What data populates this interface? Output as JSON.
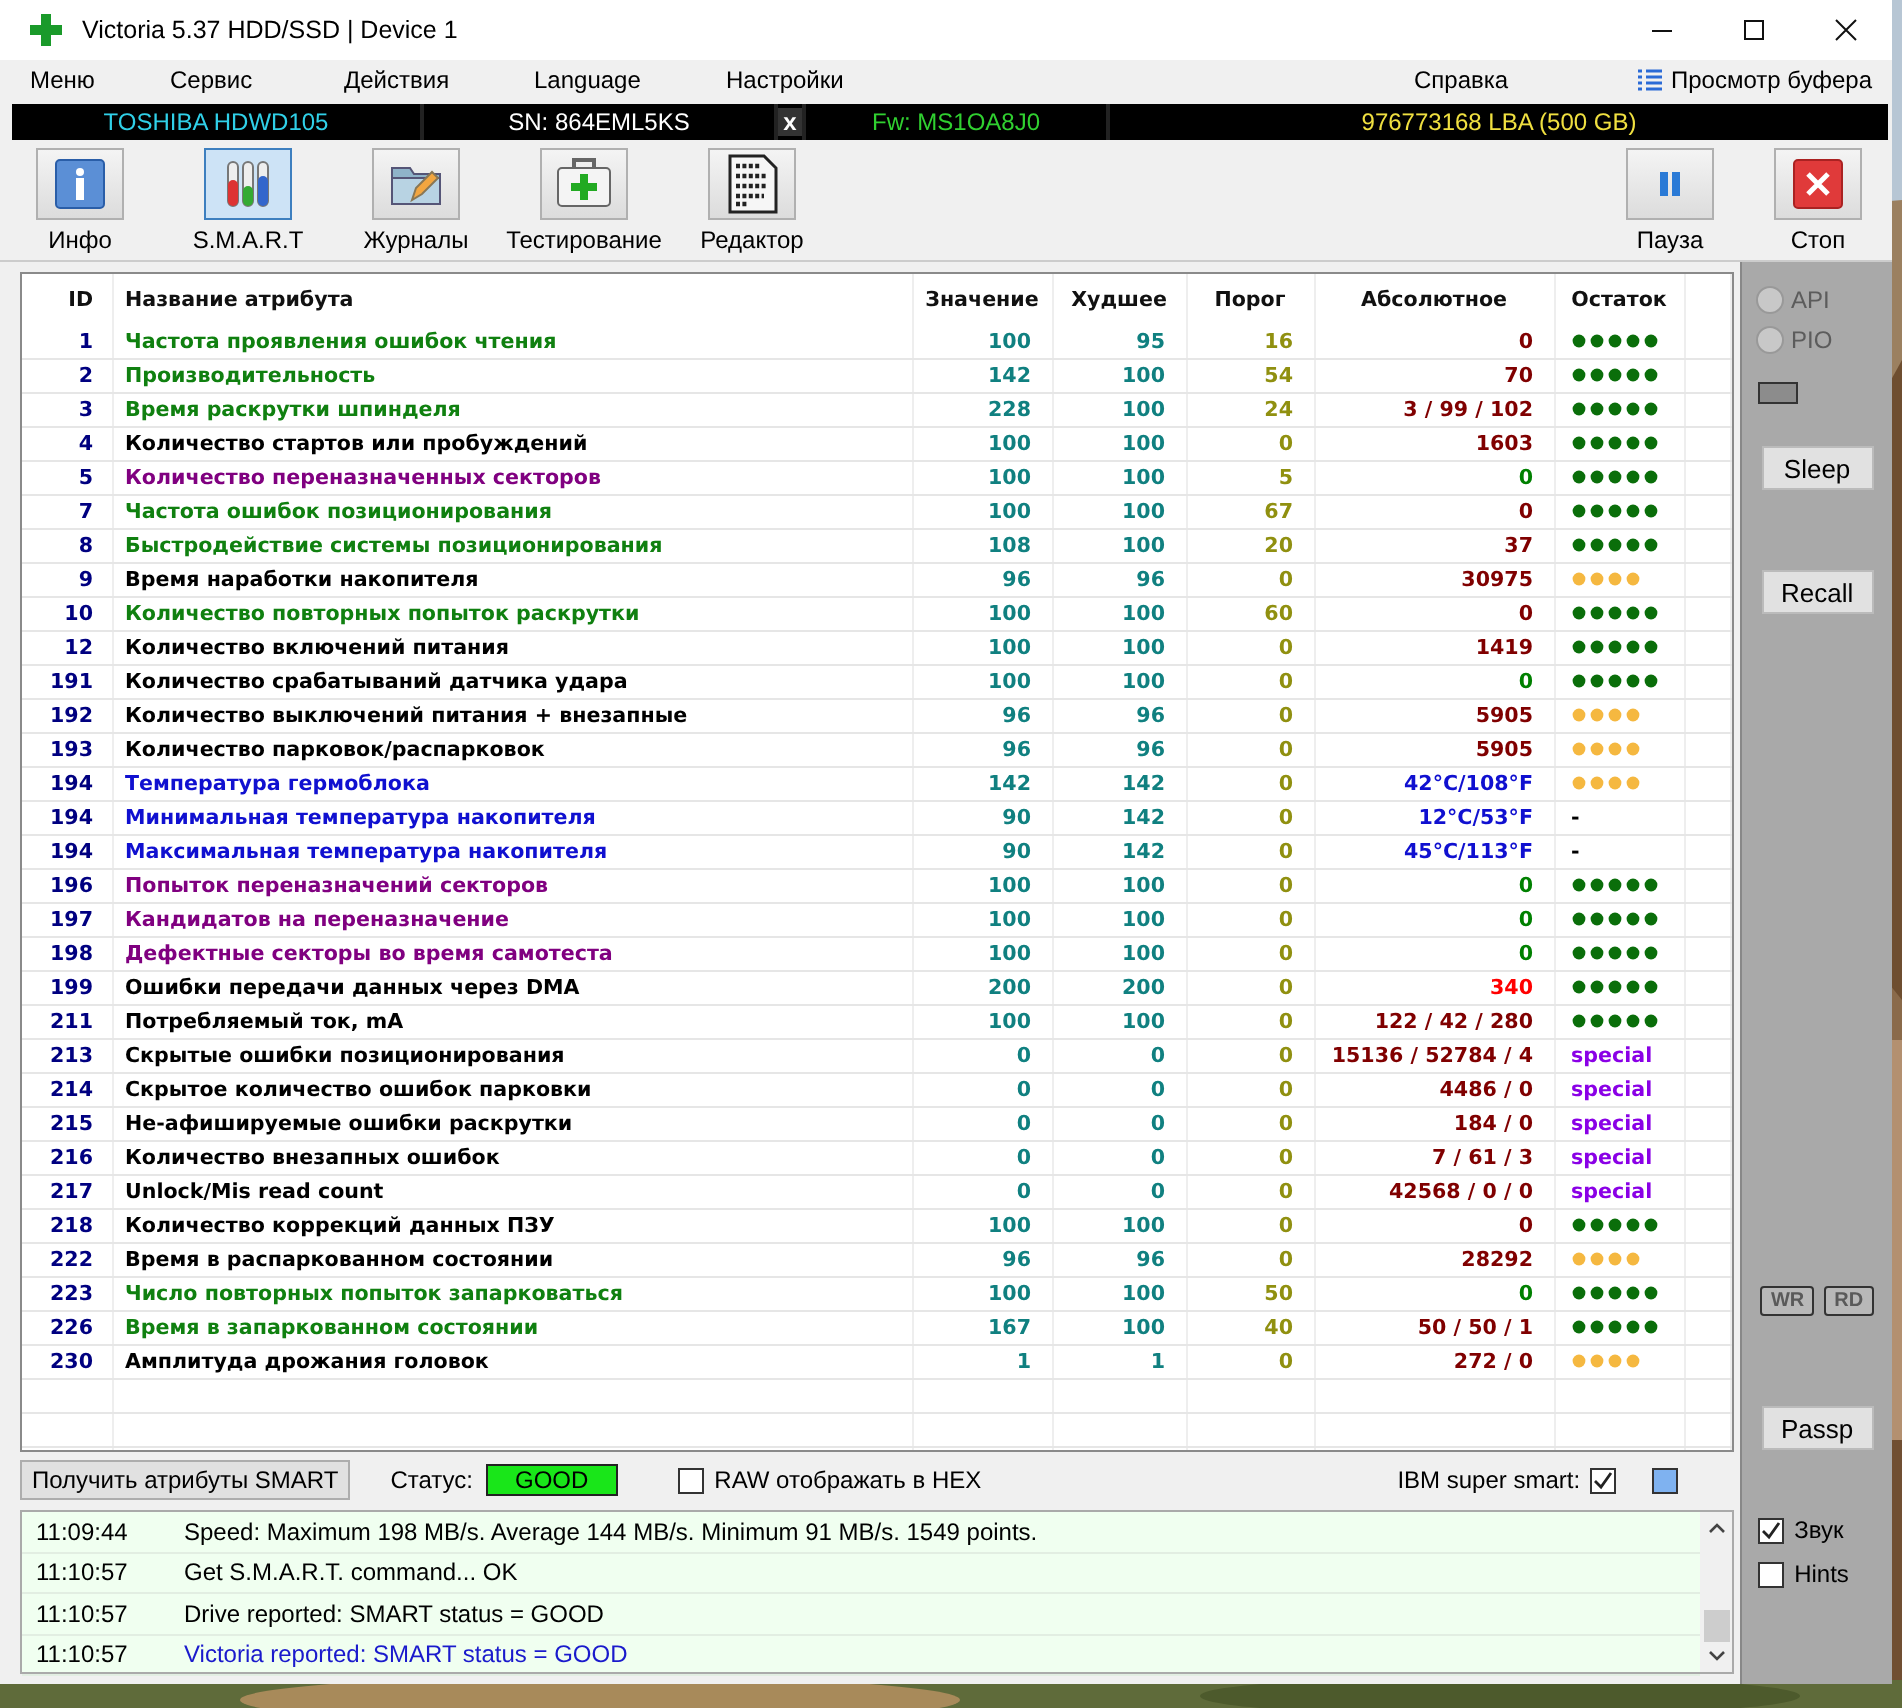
{
  "window": {
    "title": "Victoria 5.37 HDD/SSD | Device 1"
  },
  "menu": [
    "Меню",
    "Сервис",
    "Действия",
    "Language",
    "Настройки"
  ],
  "help_menu": "Справка",
  "buffer_view": "Просмотр буфера",
  "drive": {
    "model": "TOSHIBA HDWD105",
    "serial": "SN: 864EML5KS",
    "close": "x",
    "firmware": "Fw: MS1OA8J0",
    "capacity": "976773168 LBA (500 GB)"
  },
  "toolbar": [
    {
      "label": "Инфо",
      "kind": "info",
      "selected": false
    },
    {
      "label": "S.M.A.R.T",
      "kind": "smart",
      "selected": true
    },
    {
      "label": "Журналы",
      "kind": "logs",
      "selected": false
    },
    {
      "label": "Тестирование",
      "kind": "test",
      "selected": false
    },
    {
      "label": "Редактор",
      "kind": "editor",
      "selected": false
    }
  ],
  "toolbar_right": [
    {
      "label": "Пауза",
      "kind": "pause"
    },
    {
      "label": "Стоп",
      "kind": "stop"
    }
  ],
  "table": {
    "columns": [
      "ID",
      "Название атрибута",
      "Значение",
      "Худшее",
      "Порог",
      "Абсолютное",
      "Остаток"
    ],
    "rows": [
      {
        "id": "1",
        "name": "Частота проявления ошибок чтения",
        "color": "#108010",
        "value": "100",
        "worst": "95",
        "threshold": "16",
        "raw": {
          "text": "0",
          "color": "#800000"
        },
        "health": {
          "kind": "good"
        }
      },
      {
        "id": "2",
        "name": "Производительность",
        "color": "#108010",
        "value": "142",
        "worst": "100",
        "threshold": "54",
        "raw": {
          "text": "70",
          "color": "#800000"
        },
        "health": {
          "kind": "good"
        }
      },
      {
        "id": "3",
        "name": "Время раскрутки шпинделя",
        "color": "#108010",
        "value": "228",
        "worst": "100",
        "threshold": "24",
        "raw": {
          "text": "3 / 99 / 102",
          "color": "#800000"
        },
        "health": {
          "kind": "good"
        }
      },
      {
        "id": "4",
        "name": "Количество стартов или пробуждений",
        "color": "#000000",
        "value": "100",
        "worst": "100",
        "threshold": "0",
        "raw": {
          "text": "1603",
          "color": "#800000"
        },
        "health": {
          "kind": "good"
        }
      },
      {
        "id": "5",
        "name": "Количество переназначенных секторов",
        "color": "#800080",
        "value": "100",
        "worst": "100",
        "threshold": "5",
        "raw": {
          "text": "0",
          "color": "#008000"
        },
        "health": {
          "kind": "good"
        }
      },
      {
        "id": "7",
        "name": "Частота ошибок позиционирования",
        "color": "#108010",
        "value": "100",
        "worst": "100",
        "threshold": "67",
        "raw": {
          "text": "0",
          "color": "#800000"
        },
        "health": {
          "kind": "good"
        }
      },
      {
        "id": "8",
        "name": "Быстродействие системы позиционирования",
        "color": "#108010",
        "value": "108",
        "worst": "100",
        "threshold": "20",
        "raw": {
          "text": "37",
          "color": "#800000"
        },
        "health": {
          "kind": "good"
        }
      },
      {
        "id": "9",
        "name": "Время наработки накопителя",
        "color": "#000000",
        "value": "96",
        "worst": "96",
        "threshold": "0",
        "raw": {
          "text": "30975",
          "color": "#800000"
        },
        "health": {
          "kind": "fair"
        }
      },
      {
        "id": "10",
        "name": "Количество повторных попыток раскрутки",
        "color": "#108010",
        "value": "100",
        "worst": "100",
        "threshold": "60",
        "raw": {
          "text": "0",
          "color": "#800000"
        },
        "health": {
          "kind": "good"
        }
      },
      {
        "id": "12",
        "name": "Количество включений питания",
        "color": "#000000",
        "value": "100",
        "worst": "100",
        "threshold": "0",
        "raw": {
          "text": "1419",
          "color": "#800000"
        },
        "health": {
          "kind": "good"
        }
      },
      {
        "id": "191",
        "name": "Количество срабатываний датчика удара",
        "color": "#000000",
        "value": "100",
        "worst": "100",
        "threshold": "0",
        "raw": {
          "text": "0",
          "color": "#008000"
        },
        "health": {
          "kind": "good"
        }
      },
      {
        "id": "192",
        "name": "Количество выключений питания + внезапные",
        "color": "#000000",
        "value": "96",
        "worst": "96",
        "threshold": "0",
        "raw": {
          "text": "5905",
          "color": "#800000"
        },
        "health": {
          "kind": "fair"
        }
      },
      {
        "id": "193",
        "name": "Количество парковок/распарковок",
        "color": "#000000",
        "value": "96",
        "worst": "96",
        "threshold": "0",
        "raw": {
          "text": "5905",
          "color": "#800000"
        },
        "health": {
          "kind": "fair"
        }
      },
      {
        "id": "194",
        "name": "Температура гермоблока",
        "color": "#1010d0",
        "value": "142",
        "worst": "142",
        "threshold": "0",
        "raw": {
          "text": "42°C/108°F",
          "color": "#1010d0"
        },
        "health": {
          "kind": "fair"
        }
      },
      {
        "id": "194",
        "name": "Минимальная температура накопителя",
        "color": "#1010d0",
        "value": "90",
        "worst": "142",
        "threshold": "0",
        "raw": {
          "text": "12°C/53°F",
          "color": "#1010d0"
        },
        "health": {
          "kind": "text",
          "text": "-"
        }
      },
      {
        "id": "194",
        "name": "Максимальная температура накопителя",
        "color": "#1010d0",
        "value": "90",
        "worst": "142",
        "threshold": "0",
        "raw": {
          "text": "45°C/113°F",
          "color": "#1010d0"
        },
        "health": {
          "kind": "text",
          "text": "-"
        }
      },
      {
        "id": "196",
        "name": "Попыток переназначений секторов",
        "color": "#800080",
        "value": "100",
        "worst": "100",
        "threshold": "0",
        "raw": {
          "text": "0",
          "color": "#008000"
        },
        "health": {
          "kind": "good"
        }
      },
      {
        "id": "197",
        "name": "Кандидатов на переназначение",
        "color": "#800080",
        "value": "100",
        "worst": "100",
        "threshold": "0",
        "raw": {
          "text": "0",
          "color": "#008000"
        },
        "health": {
          "kind": "good"
        }
      },
      {
        "id": "198",
        "name": "Дефектные секторы во время самотеста",
        "color": "#800080",
        "value": "100",
        "worst": "100",
        "threshold": "0",
        "raw": {
          "text": "0",
          "color": "#008000"
        },
        "health": {
          "kind": "good"
        }
      },
      {
        "id": "199",
        "name": "Ошибки передачи данных через DMA",
        "color": "#000000",
        "value": "200",
        "worst": "200",
        "threshold": "0",
        "raw": {
          "text": "340",
          "color": "#ff0000"
        },
        "health": {
          "kind": "good"
        }
      },
      {
        "id": "211",
        "name": "Потребляемый ток, mA",
        "color": "#000000",
        "value": "100",
        "worst": "100",
        "threshold": "0",
        "raw": {
          "text": "122 / 42 / 280",
          "color": "#800000"
        },
        "health": {
          "kind": "good"
        }
      },
      {
        "id": "213",
        "name": "Скрытые ошибки позиционирования",
        "color": "#000000",
        "value": "0",
        "worst": "0",
        "threshold": "0",
        "raw": {
          "text": "15136 / 52784 / 4",
          "color": "#800000"
        },
        "health": {
          "kind": "special",
          "text": "special"
        }
      },
      {
        "id": "214",
        "name": "Скрытое количество ошибок парковки",
        "color": "#000000",
        "value": "0",
        "worst": "0",
        "threshold": "0",
        "raw": {
          "text": "4486 / 0",
          "color": "#800000"
        },
        "health": {
          "kind": "special",
          "text": "special"
        }
      },
      {
        "id": "215",
        "name": "Не-афишируемые ошибки раскрутки",
        "color": "#000000",
        "value": "0",
        "worst": "0",
        "threshold": "0",
        "raw": {
          "text": "184 / 0",
          "color": "#800000"
        },
        "health": {
          "kind": "special",
          "text": "special"
        }
      },
      {
        "id": "216",
        "name": "Количество внезапных ошибок",
        "color": "#000000",
        "value": "0",
        "worst": "0",
        "threshold": "0",
        "raw": {
          "text": "7 / 61 / 3",
          "color": "#800000"
        },
        "health": {
          "kind": "special",
          "text": "special"
        }
      },
      {
        "id": "217",
        "name": "Unlock/Mis read count",
        "color": "#000000",
        "value": "0",
        "worst": "0",
        "threshold": "0",
        "raw": {
          "text": "42568 / 0 / 0",
          "color": "#800000"
        },
        "health": {
          "kind": "special",
          "text": "special"
        }
      },
      {
        "id": "218",
        "name": "Количество коррекций данных ПЗУ",
        "color": "#000000",
        "value": "100",
        "worst": "100",
        "threshold": "0",
        "raw": {
          "text": "0",
          "color": "#800000"
        },
        "health": {
          "kind": "good"
        }
      },
      {
        "id": "222",
        "name": "Время в распаркованном состоянии",
        "color": "#000000",
        "value": "96",
        "worst": "96",
        "threshold": "0",
        "raw": {
          "text": "28292",
          "color": "#800000"
        },
        "health": {
          "kind": "fair"
        }
      },
      {
        "id": "223",
        "name": "Число повторных попыток запарковаться",
        "color": "#108010",
        "value": "100",
        "worst": "100",
        "threshold": "50",
        "raw": {
          "text": "0",
          "color": "#008000"
        },
        "health": {
          "kind": "good"
        }
      },
      {
        "id": "226",
        "name": "Время в запаркованном состоянии",
        "color": "#108010",
        "value": "167",
        "worst": "100",
        "threshold": "40",
        "raw": {
          "text": "50 / 50 / 1",
          "color": "#800000"
        },
        "health": {
          "kind": "good"
        }
      },
      {
        "id": "230",
        "name": "Амплитуда дрожания головок",
        "color": "#000000",
        "value": "1",
        "worst": "1",
        "threshold": "0",
        "raw": {
          "text": "272 / 0",
          "color": "#800000"
        },
        "health": {
          "kind": "fair"
        }
      }
    ]
  },
  "side": {
    "modes": [
      {
        "label": "API",
        "checked": false,
        "disabled": true
      },
      {
        "label": "PIO",
        "checked": false,
        "disabled": true
      }
    ],
    "buttons": [
      "Sleep",
      "Recall"
    ],
    "indicators": [
      "WR",
      "RD"
    ],
    "passp": "Passp"
  },
  "smart_bar": {
    "button": "Получить атрибуты SMART",
    "status_label": "Статус:",
    "status": "GOOD",
    "raw_hex": {
      "label": "RAW отображать в HEX",
      "checked": false
    },
    "ibm": {
      "label": "IBM super smart:",
      "checked": true
    }
  },
  "log": [
    {
      "time": "11:09:44",
      "message": "Speed: Maximum 198 MB/s. Average 144 MB/s. Minimum 91 MB/s. 1549 points.",
      "color": "#000000"
    },
    {
      "time": "11:10:57",
      "message": "Get S.M.A.R.T. command... OK",
      "color": "#000000"
    },
    {
      "time": "11:10:57",
      "message": "Drive reported: SMART status = GOOD",
      "color": "#000000"
    },
    {
      "time": "11:10:57",
      "message": "Victoria reported: SMART status = GOOD",
      "color": "#1a1acc"
    }
  ],
  "options": [
    {
      "label": "Звук",
      "checked": true
    },
    {
      "label": "Hints",
      "checked": false
    }
  ]
}
